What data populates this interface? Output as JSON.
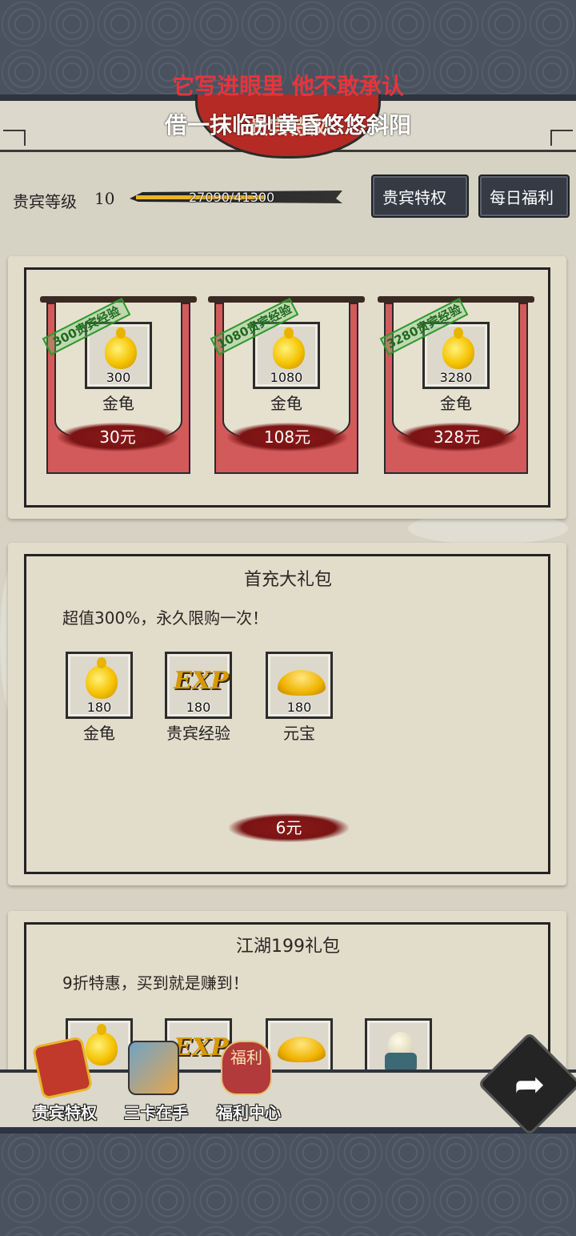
{
  "overlay": {
    "line1": "它写进眼里 他不敢承认",
    "line2": "借一抹临别黄昏悠悠斜阳"
  },
  "header": {
    "title": "贵宾特权"
  },
  "vip": {
    "label": "贵宾等级",
    "level": "10",
    "progress_text": "27090/41300",
    "progress_fraction": 0.656
  },
  "top_buttons": {
    "vip_privilege": "贵宾特权",
    "daily_welfare": "每日福利"
  },
  "recharge_packs": [
    {
      "stamp": "300贵宾经验",
      "item_count": "300",
      "item_name": "金龟",
      "price": "30元",
      "icon": "gold-gourd-icon"
    },
    {
      "stamp": "1080贵宾经验",
      "item_count": "1080",
      "item_name": "金龟",
      "price": "108元",
      "icon": "gold-gourd-icon"
    },
    {
      "stamp": "3280贵宾经验",
      "item_count": "3280",
      "item_name": "金龟",
      "price": "328元",
      "icon": "gold-gourd-icon"
    }
  ],
  "first_pack": {
    "title": "首充大礼包",
    "description": "超值300%，永久限购一次！",
    "items": [
      {
        "count": "180",
        "name": "金龟",
        "icon": "gold-gourd-icon"
      },
      {
        "count": "180",
        "name": "贵宾经验",
        "icon": "exp-icon"
      },
      {
        "count": "180",
        "name": "元宝",
        "icon": "gold-ingot-icon"
      }
    ],
    "price": "6元"
  },
  "jianghu_pack": {
    "title": "江湖199礼包",
    "description": "9折特惠，买到就是赚到！",
    "items": [
      {
        "icon": "gold-gourd-icon"
      },
      {
        "icon": "exp-icon"
      },
      {
        "icon": "gold-ingot-icon"
      },
      {
        "icon": "crystal-orb-icon"
      }
    ]
  },
  "bottom_nav": {
    "vip": "贵宾特权",
    "cards": "三卡在手",
    "welfare": "福利中心",
    "welfare_icon_text": "福利"
  },
  "colors": {
    "accent_red": "#b52a24",
    "banner_red": "#d25a5a",
    "gold": "#f5c200",
    "stamp_green": "#2a9a2a",
    "dark_frame": "#2e3440"
  }
}
